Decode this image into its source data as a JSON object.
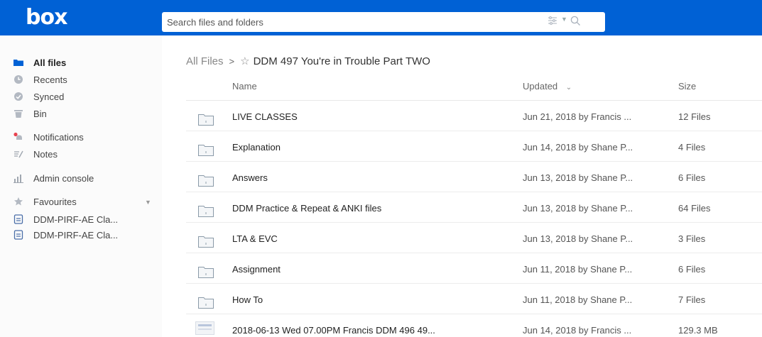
{
  "header": {
    "logo_text": "box",
    "search_placeholder": "Search files and folders"
  },
  "sidebar": {
    "items": [
      {
        "label": "All files",
        "icon": "folder-icon"
      },
      {
        "label": "Recents",
        "icon": "clock-icon"
      },
      {
        "label": "Synced",
        "icon": "sync-icon"
      },
      {
        "label": "Bin",
        "icon": "trash-icon"
      },
      {
        "label": "Notifications",
        "icon": "bell-icon"
      },
      {
        "label": "Notes",
        "icon": "notes-icon"
      },
      {
        "label": "Admin console",
        "icon": "bar-chart-icon"
      },
      {
        "label": "Favourites",
        "icon": "star-icon"
      },
      {
        "label": "DDM-PIRF-AE Cla...",
        "icon": "document-icon"
      },
      {
        "label": "DDM-PIRF-AE Cla...",
        "icon": "document-icon"
      }
    ]
  },
  "breadcrumb": {
    "root": "All Files",
    "separator": ">",
    "current": "DDM 497 You're in Trouble Part TWO"
  },
  "table": {
    "columns": {
      "name": "Name",
      "updated": "Updated",
      "size": "Size"
    },
    "rows": [
      {
        "name": "LIVE CLASSES",
        "updated": "Jun 21, 2018 by Francis ...",
        "size": "12 Files",
        "type": "folder"
      },
      {
        "name": "Explanation",
        "updated": "Jun 14, 2018 by Shane P...",
        "size": "4 Files",
        "type": "folder"
      },
      {
        "name": "Answers",
        "updated": "Jun 13, 2018 by Shane P...",
        "size": "6 Files",
        "type": "folder"
      },
      {
        "name": "DDM Practice & Repeat & ANKI files",
        "updated": "Jun 13, 2018 by Shane P...",
        "size": "64 Files",
        "type": "folder"
      },
      {
        "name": "LTA & EVC",
        "updated": "Jun 13, 2018 by Shane P...",
        "size": "3 Files",
        "type": "folder"
      },
      {
        "name": "Assignment",
        "updated": "Jun 11, 2018 by Shane P...",
        "size": "6 Files",
        "type": "folder"
      },
      {
        "name": "How To",
        "updated": "Jun 11, 2018 by Shane P...",
        "size": "7 Files",
        "type": "folder"
      },
      {
        "name": "2018-06-13 Wed 07.00PM Francis DDM 496 49...",
        "updated": "Jun 14, 2018 by Francis ...",
        "size": "129.3 MB",
        "type": "file"
      }
    ]
  },
  "colors": {
    "brand": "#0061d5",
    "folder": "#8a9aa8"
  }
}
